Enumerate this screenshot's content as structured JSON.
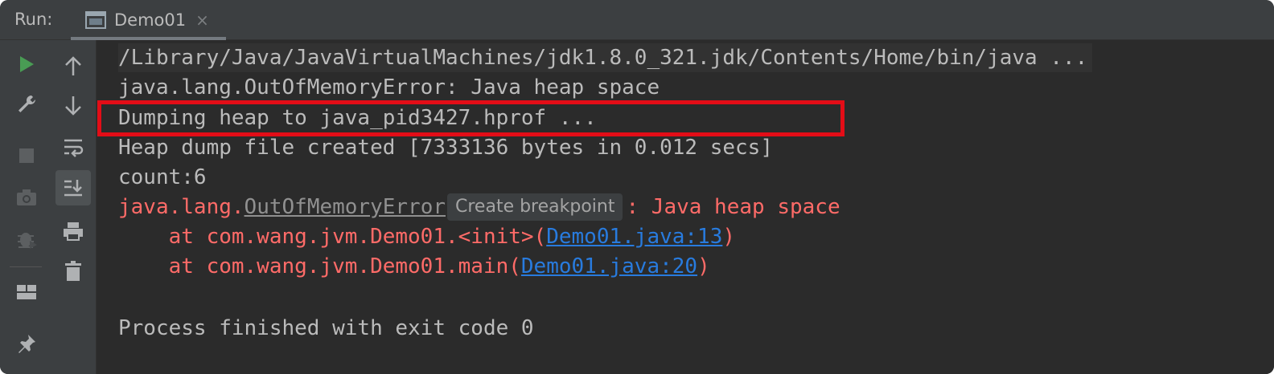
{
  "tabbar": {
    "run_label": "Run:",
    "tab_title": "Demo01",
    "tab_close": "×"
  },
  "toolbar_left": [
    {
      "name": "rerun-icon",
      "color": "#4caf50"
    },
    {
      "name": "wrench-icon"
    },
    {
      "name": "stop-icon"
    },
    {
      "name": "camera-icon"
    },
    {
      "name": "debug-bug-icon"
    },
    {
      "name": "layout-icon"
    },
    {
      "name": "pin-icon"
    }
  ],
  "toolbar_right": [
    {
      "name": "arrow-up-icon"
    },
    {
      "name": "arrow-down-icon"
    },
    {
      "name": "soft-wrap-icon"
    },
    {
      "name": "scroll-to-end-icon",
      "active": true
    },
    {
      "name": "print-icon"
    },
    {
      "name": "trash-icon"
    }
  ],
  "console": {
    "line1": "/Library/Java/JavaVirtualMachines/jdk1.8.0_321.jdk/Contents/Home/bin/java ...",
    "line2": "java.lang.OutOfMemoryError: Java heap space",
    "line3": "Dumping heap to java_pid3427.hprof ...",
    "line4": "Heap dump file created [7333136 bytes in 0.012 secs]",
    "line5": "count:6",
    "line6_prefix": "java.lang.",
    "line6_class": "OutOfMemoryError",
    "tooltip": "Create breakpoint",
    "line6_suffix": ": Java heap space",
    "line7_prefix": "    at com.wang.jvm.Demo01.<init>(",
    "line7_link": "Demo01.java:13",
    "line7_suffix": ")",
    "line8_prefix": "    at com.wang.jvm.Demo01.main(",
    "line8_link": "Demo01.java:20",
    "line8_suffix": ")",
    "line9": "Process finished with exit code 0"
  },
  "colors": {
    "error_text": "#ff6b68",
    "link_text": "#287bde",
    "highlight_box": "#e30d17"
  }
}
